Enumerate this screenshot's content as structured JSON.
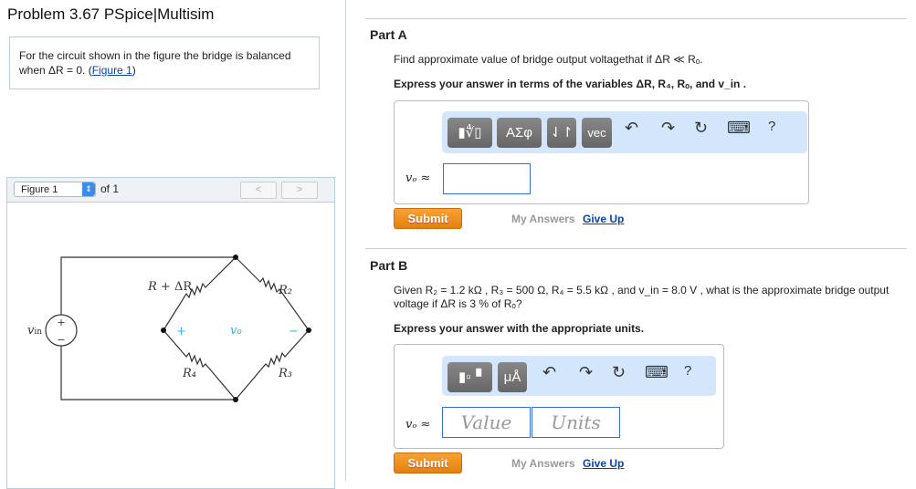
{
  "title": "Problem 3.67 PSpice|Multisim",
  "intro": {
    "text": "For the circuit shown in the figure the bridge is balanced when ΔR = 0. (",
    "link": "Figure 1",
    "close": ")"
  },
  "figure": {
    "select": "Figure 1",
    "of": "of 1",
    "prev": "<",
    "next": ">",
    "labels": {
      "vin": "v",
      "vin_sub": "in",
      "ro": "R",
      "ro_rest": " + ΔR",
      "r2": "R₂",
      "r3": "R₃",
      "r4": "R₄",
      "plus": "+",
      "minus": "−",
      "vo": "v",
      "vo_sub": "o",
      "src_plus": "+",
      "src_minus": "−"
    }
  },
  "partA": {
    "heading": "Part A",
    "question": "Find approximate value of bridge output voltagethat if ΔR ≪ Rₒ.",
    "instruction": "Express your answer in terms of the variables ΔR, R₄, Rₒ, and v_in .",
    "toolbar": {
      "templates": "▮∜▯",
      "greek": "ΑΣφ",
      "arrows": "⇃↾",
      "vec": "vec",
      "undo": "↶",
      "redo": "↷",
      "reset": "↻",
      "keyboard": "⌨",
      "help": "?"
    },
    "label": "vₒ ≈",
    "input_value": "",
    "submit": "Submit",
    "my_answers": "My Answers",
    "give_up": "Give Up"
  },
  "partB": {
    "heading": "Part B",
    "question": "Given R₂ = 1.2 kΩ , R₃ = 500 Ω, R₄ = 5.5 kΩ , and v_in = 8.0 V , what is the approximate bridge output voltage if ΔR is 3 % of Rₒ?",
    "instruction": "Express your answer with the appropriate units.",
    "toolbar": {
      "templates": "▮▫▝",
      "units": "μÅ",
      "undo": "↶",
      "redo": "↷",
      "reset": "↻",
      "keyboard": "⌨",
      "help": "?"
    },
    "label": "vₒ ≈",
    "value_placeholder": "Value",
    "units_placeholder": "Units",
    "submit": "Submit",
    "my_answers": "My Answers",
    "give_up": "Give Up"
  }
}
